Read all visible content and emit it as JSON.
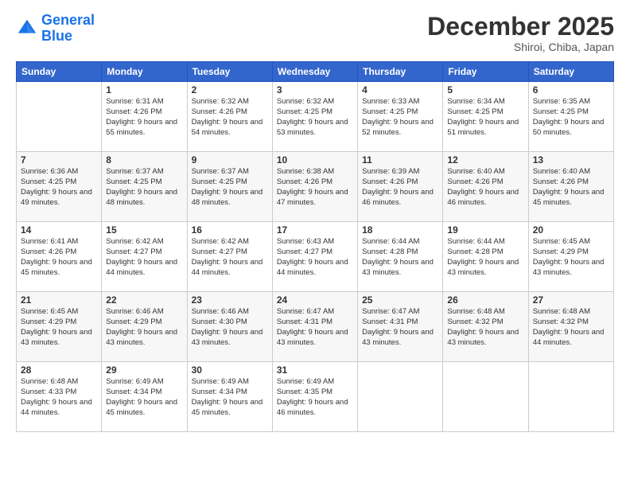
{
  "header": {
    "logo_line1": "General",
    "logo_line2": "Blue",
    "month_title": "December 2025",
    "location": "Shiroi, Chiba, Japan"
  },
  "days_of_week": [
    "Sunday",
    "Monday",
    "Tuesday",
    "Wednesday",
    "Thursday",
    "Friday",
    "Saturday"
  ],
  "weeks": [
    [
      {
        "day": "",
        "sunrise": "",
        "sunset": "",
        "daylight": ""
      },
      {
        "day": "1",
        "sunrise": "Sunrise: 6:31 AM",
        "sunset": "Sunset: 4:26 PM",
        "daylight": "Daylight: 9 hours and 55 minutes."
      },
      {
        "day": "2",
        "sunrise": "Sunrise: 6:32 AM",
        "sunset": "Sunset: 4:26 PM",
        "daylight": "Daylight: 9 hours and 54 minutes."
      },
      {
        "day": "3",
        "sunrise": "Sunrise: 6:32 AM",
        "sunset": "Sunset: 4:25 PM",
        "daylight": "Daylight: 9 hours and 53 minutes."
      },
      {
        "day": "4",
        "sunrise": "Sunrise: 6:33 AM",
        "sunset": "Sunset: 4:25 PM",
        "daylight": "Daylight: 9 hours and 52 minutes."
      },
      {
        "day": "5",
        "sunrise": "Sunrise: 6:34 AM",
        "sunset": "Sunset: 4:25 PM",
        "daylight": "Daylight: 9 hours and 51 minutes."
      },
      {
        "day": "6",
        "sunrise": "Sunrise: 6:35 AM",
        "sunset": "Sunset: 4:25 PM",
        "daylight": "Daylight: 9 hours and 50 minutes."
      }
    ],
    [
      {
        "day": "7",
        "sunrise": "Sunrise: 6:36 AM",
        "sunset": "Sunset: 4:25 PM",
        "daylight": "Daylight: 9 hours and 49 minutes."
      },
      {
        "day": "8",
        "sunrise": "Sunrise: 6:37 AM",
        "sunset": "Sunset: 4:25 PM",
        "daylight": "Daylight: 9 hours and 48 minutes."
      },
      {
        "day": "9",
        "sunrise": "Sunrise: 6:37 AM",
        "sunset": "Sunset: 4:25 PM",
        "daylight": "Daylight: 9 hours and 48 minutes."
      },
      {
        "day": "10",
        "sunrise": "Sunrise: 6:38 AM",
        "sunset": "Sunset: 4:26 PM",
        "daylight": "Daylight: 9 hours and 47 minutes."
      },
      {
        "day": "11",
        "sunrise": "Sunrise: 6:39 AM",
        "sunset": "Sunset: 4:26 PM",
        "daylight": "Daylight: 9 hours and 46 minutes."
      },
      {
        "day": "12",
        "sunrise": "Sunrise: 6:40 AM",
        "sunset": "Sunset: 4:26 PM",
        "daylight": "Daylight: 9 hours and 46 minutes."
      },
      {
        "day": "13",
        "sunrise": "Sunrise: 6:40 AM",
        "sunset": "Sunset: 4:26 PM",
        "daylight": "Daylight: 9 hours and 45 minutes."
      }
    ],
    [
      {
        "day": "14",
        "sunrise": "Sunrise: 6:41 AM",
        "sunset": "Sunset: 4:26 PM",
        "daylight": "Daylight: 9 hours and 45 minutes."
      },
      {
        "day": "15",
        "sunrise": "Sunrise: 6:42 AM",
        "sunset": "Sunset: 4:27 PM",
        "daylight": "Daylight: 9 hours and 44 minutes."
      },
      {
        "day": "16",
        "sunrise": "Sunrise: 6:42 AM",
        "sunset": "Sunset: 4:27 PM",
        "daylight": "Daylight: 9 hours and 44 minutes."
      },
      {
        "day": "17",
        "sunrise": "Sunrise: 6:43 AM",
        "sunset": "Sunset: 4:27 PM",
        "daylight": "Daylight: 9 hours and 44 minutes."
      },
      {
        "day": "18",
        "sunrise": "Sunrise: 6:44 AM",
        "sunset": "Sunset: 4:28 PM",
        "daylight": "Daylight: 9 hours and 43 minutes."
      },
      {
        "day": "19",
        "sunrise": "Sunrise: 6:44 AM",
        "sunset": "Sunset: 4:28 PM",
        "daylight": "Daylight: 9 hours and 43 minutes."
      },
      {
        "day": "20",
        "sunrise": "Sunrise: 6:45 AM",
        "sunset": "Sunset: 4:29 PM",
        "daylight": "Daylight: 9 hours and 43 minutes."
      }
    ],
    [
      {
        "day": "21",
        "sunrise": "Sunrise: 6:45 AM",
        "sunset": "Sunset: 4:29 PM",
        "daylight": "Daylight: 9 hours and 43 minutes."
      },
      {
        "day": "22",
        "sunrise": "Sunrise: 6:46 AM",
        "sunset": "Sunset: 4:29 PM",
        "daylight": "Daylight: 9 hours and 43 minutes."
      },
      {
        "day": "23",
        "sunrise": "Sunrise: 6:46 AM",
        "sunset": "Sunset: 4:30 PM",
        "daylight": "Daylight: 9 hours and 43 minutes."
      },
      {
        "day": "24",
        "sunrise": "Sunrise: 6:47 AM",
        "sunset": "Sunset: 4:31 PM",
        "daylight": "Daylight: 9 hours and 43 minutes."
      },
      {
        "day": "25",
        "sunrise": "Sunrise: 6:47 AM",
        "sunset": "Sunset: 4:31 PM",
        "daylight": "Daylight: 9 hours and 43 minutes."
      },
      {
        "day": "26",
        "sunrise": "Sunrise: 6:48 AM",
        "sunset": "Sunset: 4:32 PM",
        "daylight": "Daylight: 9 hours and 43 minutes."
      },
      {
        "day": "27",
        "sunrise": "Sunrise: 6:48 AM",
        "sunset": "Sunset: 4:32 PM",
        "daylight": "Daylight: 9 hours and 44 minutes."
      }
    ],
    [
      {
        "day": "28",
        "sunrise": "Sunrise: 6:48 AM",
        "sunset": "Sunset: 4:33 PM",
        "daylight": "Daylight: 9 hours and 44 minutes."
      },
      {
        "day": "29",
        "sunrise": "Sunrise: 6:49 AM",
        "sunset": "Sunset: 4:34 PM",
        "daylight": "Daylight: 9 hours and 45 minutes."
      },
      {
        "day": "30",
        "sunrise": "Sunrise: 6:49 AM",
        "sunset": "Sunset: 4:34 PM",
        "daylight": "Daylight: 9 hours and 45 minutes."
      },
      {
        "day": "31",
        "sunrise": "Sunrise: 6:49 AM",
        "sunset": "Sunset: 4:35 PM",
        "daylight": "Daylight: 9 hours and 46 minutes."
      },
      {
        "day": "",
        "sunrise": "",
        "sunset": "",
        "daylight": ""
      },
      {
        "day": "",
        "sunrise": "",
        "sunset": "",
        "daylight": ""
      },
      {
        "day": "",
        "sunrise": "",
        "sunset": "",
        "daylight": ""
      }
    ]
  ]
}
